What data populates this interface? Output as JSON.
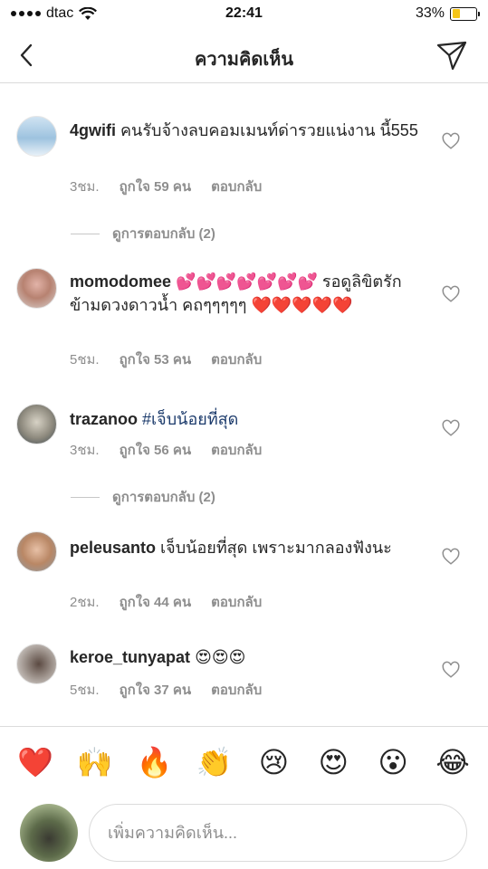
{
  "status_bar": {
    "carrier": "dtac",
    "time": "22:41",
    "battery": "33%",
    "battery_level": 0.33
  },
  "header": {
    "title": "ความคิดเห็น",
    "back_icon": "chevron-left-icon",
    "send_icon": "paper-plane-icon"
  },
  "comments": [
    {
      "username": "4gwifi",
      "text": "คนรับจ้างลบคอมเมนท์ด่ารวยแน่งาน นี้555",
      "time": "3ชม.",
      "likes": "ถูกใจ 59 คน",
      "reply": "ตอบกลับ",
      "view_replies": "ดูการตอบกลับ (2)"
    },
    {
      "username": "momodomee",
      "text": "💕💕💕💕💕💕💕 รอดูลิขิตรักข้ามดวงดาวน้ำ คถๆๆๆๆๆ ❤️❤️❤️❤️❤️",
      "time": "5ชม.",
      "likes": "ถูกใจ 53 คน",
      "reply": "ตอบกลับ"
    },
    {
      "username": "trazanoo",
      "text": "#เจ็บน้อยที่สุด",
      "time": "3ชม.",
      "likes": "ถูกใจ 56 คน",
      "reply": "ตอบกลับ",
      "view_replies": "ดูการตอบกลับ (2)"
    },
    {
      "username": "peleusanto",
      "text": "เจ็บน้อยที่สุด เพราะมากลองฟังนะ",
      "time": "2ชม.",
      "likes": "ถูกใจ 44 คน",
      "reply": "ตอบกลับ"
    },
    {
      "username": "keroe_tunyapat",
      "text": "😍😍😍",
      "time": "5ชม.",
      "likes": "ถูกใจ 37 คน",
      "reply": "ตอบกลับ"
    }
  ],
  "emoji_bar": [
    "❤️",
    "🙌",
    "🔥",
    "👏",
    "😢",
    "😍",
    "😮",
    "😂"
  ],
  "composer": {
    "placeholder": "เพิ่มความคิดเห็น..."
  },
  "colors": {
    "accent_battery": "#f5c518",
    "text": "#262626",
    "muted": "#8e8e8e",
    "hashtag": "#1b3a6b"
  }
}
